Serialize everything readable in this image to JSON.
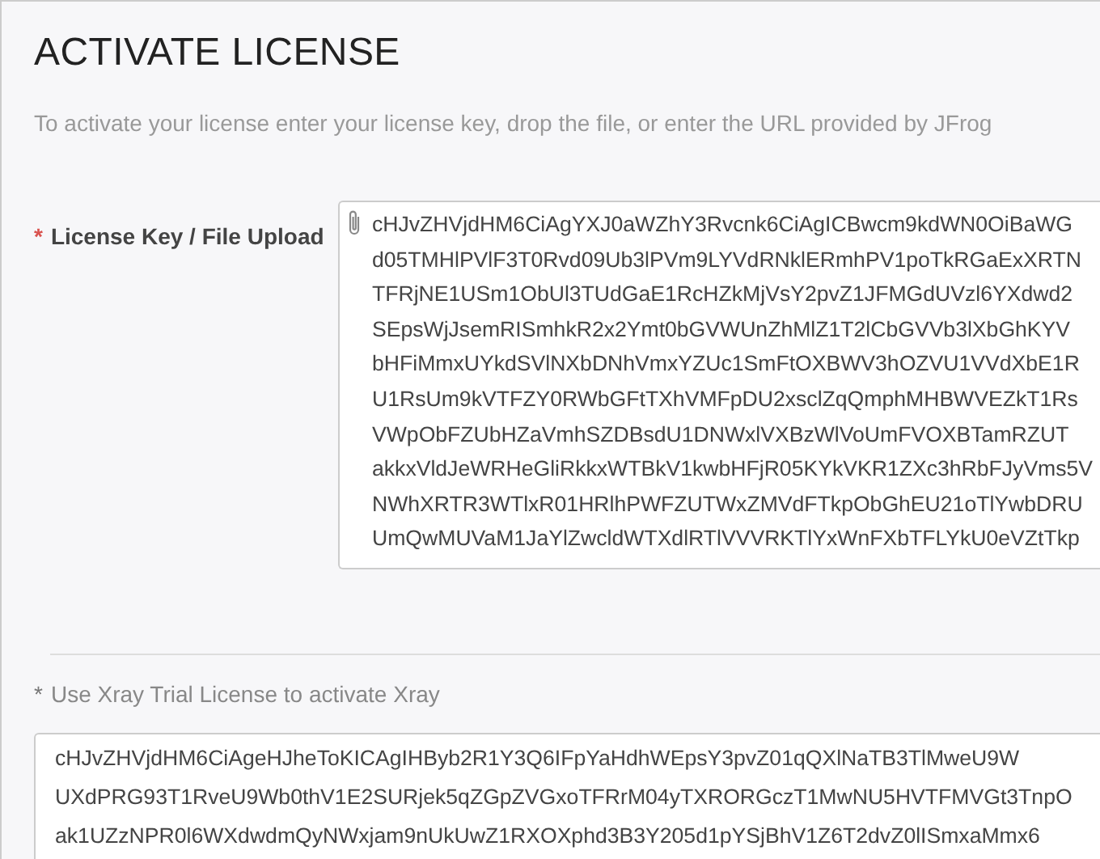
{
  "title": "ACTIVATE LICENSE",
  "description": "To activate your license enter your license key, drop the file, or enter the URL provided by JFrog",
  "fields": [
    {
      "kind": "upload",
      "marker": "*",
      "label": "License Key / File Upload",
      "lines": [
        "cHJvZHVjdHM6CiAgYXJ0aWZhY3Rvcnk6CiAgICBwcm9kdWN0OiBaWG",
        "d05TMHlPVlF3T0Rvd09Ub3lPVm9LYVdRNklERmhPV1poTkRGaExXRTN",
        "TFRjNE1USm1ObUl3TUdGaE1RcHZkMjVsY2pvZ1JFMGdUVzl6YXdwd2",
        "SEpsWjJsemRISmhkR2x2Ymt0bGVWUnZhMlZ1T2lCbGVVb3lXbGhKYV",
        "bHFiMmxUYkdSVlNXbDNhVmxYZUc1SmFtOXBWV3hOZVU1VVdXbE1R",
        "U1RsUm9kVTFZY0RWbGFtTXhVMFpDU2xsclZqQmphMHBWVEZkT1Rs",
        "VWpObFZUbHZaVmhSZDBsdU1DNWxlVXBzWlVoUmFVOXBTamRZUT",
        "akkxVldJeWRHeGliRkkxWTBkV1kwbHFjR05KYkVKR1ZXc3hRbFJyVms5V",
        "NWhXRTR3WTlxR01HRlhPWFZUTWxZMVdFTkpObGhEU21oTlYwbDRU",
        "UmQwMUVaM1JaYlZwcldWTXdlRTlVVVRKTlYxWnFXbTFLYkU0eVZtTkp"
      ]
    },
    {
      "kind": "plain",
      "marker": "*",
      "label": "Use Xray Trial License to activate Xray",
      "lines": [
        "cHJvZHVjdHM6CiAgeHJheToKICAgIHByb2R1Y3Q6IFpYaHdhWEpsY3pvZ01qQXlNaTB3TlMweU9W",
        "UXdPRG93T1RveU9Wb0thV1E2SURjek5qZGpZVGxoTFRrM04yTXRORGczT1MwNU5HVTFMVGt3TnpO",
        "ak1UZzNPR0l6WXdwdmQyNWxjam9nUkUwZ1RXOXphd3B3Y205d1pYSjBhV1Z6T2dvZ0lISmxaMmx6"
      ]
    }
  ]
}
